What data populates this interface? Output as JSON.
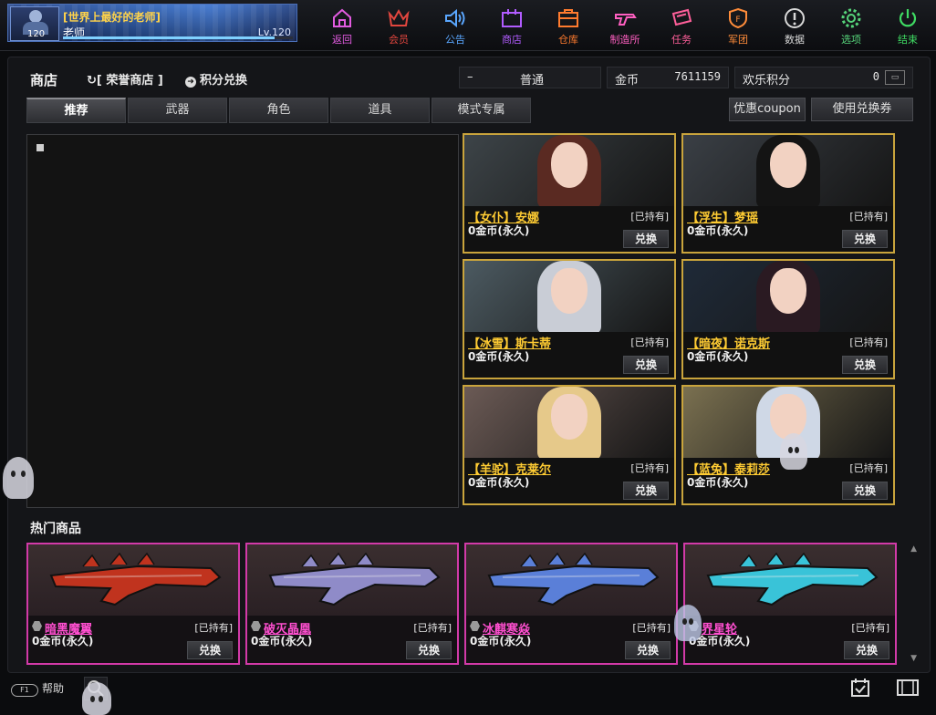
{
  "profile": {
    "title": "[世界上最好的老师]",
    "name": "老师",
    "level_text": "Lv.120",
    "avatar_level": "120",
    "exp_fraction": 0.92
  },
  "nav": [
    {
      "label": "返回",
      "icon": "home-icon",
      "color": "#e25be0"
    },
    {
      "label": "会员",
      "icon": "crown-icon",
      "color": "#e2463e"
    },
    {
      "label": "公告",
      "icon": "speaker-icon",
      "color": "#5aa7ff"
    },
    {
      "label": "商店",
      "icon": "shop-icon",
      "color": "#b15cff"
    },
    {
      "label": "仓库",
      "icon": "warehouse-icon",
      "color": "#ff7b2e"
    },
    {
      "label": "制造所",
      "icon": "gun-icon",
      "color": "#ff5fc1"
    },
    {
      "label": "任务",
      "icon": "ticket-icon",
      "color": "#ff5f9a"
    },
    {
      "label": "军团",
      "icon": "shield-icon",
      "color": "#ff8c3a"
    },
    {
      "label": "数据",
      "icon": "info-icon",
      "color": "#d8d8d8"
    },
    {
      "label": "选项",
      "icon": "gear-icon",
      "color": "#56d47a"
    },
    {
      "label": "结束",
      "icon": "power-icon",
      "color": "#3fdc63"
    }
  ],
  "shop": {
    "title": "商店",
    "honor_shop": "[ 荣誉商店 ]",
    "points_exchange": "积分兑换",
    "mode": {
      "dash": "–",
      "label": "普通"
    },
    "gold": {
      "label": "金币",
      "value": "7611159"
    },
    "points": {
      "label": "欢乐积分",
      "value": "0"
    },
    "tabs": [
      "推荐",
      "武器",
      "角色",
      "道具",
      "模式专属"
    ],
    "coupon_btn": "优惠coupon",
    "use_voucher_btn": "使用兑换券",
    "hot_title": "热门商品"
  },
  "characters": [
    {
      "name": "【女仆】安娜",
      "owned": "[已持有]",
      "price": "0金币(永久)",
      "exchange": "兑换",
      "hair": "#5a2a22",
      "bg": "#3d4448"
    },
    {
      "name": "【浮生】梦瑶",
      "owned": "[已持有]",
      "price": "0金币(永久)",
      "exchange": "兑换",
      "hair": "#141414",
      "bg": "#3a3f45"
    },
    {
      "name": "【冰雪】斯卡蒂",
      "owned": "[已持有]",
      "price": "0金币(永久)",
      "exchange": "兑换",
      "hair": "#c9cdd6",
      "bg": "#4c5a61"
    },
    {
      "name": "【暗夜】诺克斯",
      "owned": "[已持有]",
      "price": "0金币(永久)",
      "exchange": "兑换",
      "hair": "#2a1a22",
      "bg": "#1f2a38"
    },
    {
      "name": "【羊驼】克莱尔",
      "owned": "[已持有]",
      "price": "0金币(永久)",
      "exchange": "兑换",
      "hair": "#e6c98a",
      "bg": "#6b5a55"
    },
    {
      "name": "【蓝兔】泰莉莎",
      "owned": "[已持有]",
      "price": "0金币(永久)",
      "exchange": "兑换",
      "hair": "#cfd8e6",
      "bg": "#7a7050"
    }
  ],
  "hot_items": [
    {
      "name": "暗黑魔翼",
      "owned": "[已持有]",
      "price": "0金币(永久)",
      "exchange": "兑换",
      "color": "#c0331e"
    },
    {
      "name": "破灭晶凰",
      "owned": "[已持有]",
      "price": "0金币(永久)",
      "exchange": "兑换",
      "color": "#8f8bc8"
    },
    {
      "name": "冰麒寒焱",
      "owned": "[已持有]",
      "price": "0金币(永久)",
      "exchange": "兑换",
      "color": "#5a7fd8"
    },
    {
      "name": "界星轮",
      "owned": "[已持有]",
      "price": "0金币(永久)",
      "exchange": "兑换",
      "color": "#39c3d8"
    }
  ],
  "bottom": {
    "help": "帮助",
    "help_pill": "F1"
  }
}
